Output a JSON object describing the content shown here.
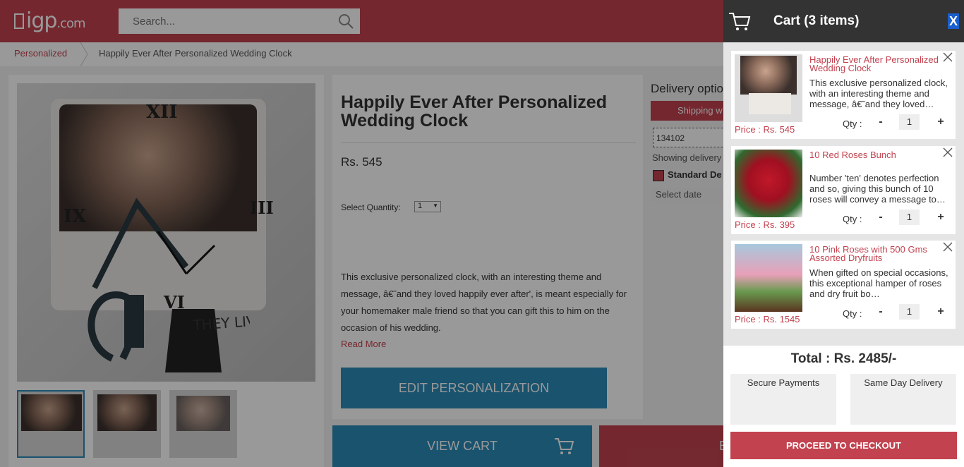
{
  "header": {
    "logo_text": "igp",
    "logo_suffix": ".com",
    "search_placeholder": "Search..."
  },
  "breadcrumb": {
    "parent": "Personalized",
    "current": "Happily Ever After Personalized Wedding Clock"
  },
  "product": {
    "title": "Happily Ever After Personalized Wedding Clock",
    "price": "Rs. 545",
    "quantity_label": "Select Quantity:",
    "quantity_value": "1",
    "description": "This exclusive personalized clock, with an interesting theme and message, â€˜and they loved happily ever after', is meant especially for your homemaker male friend so that you can gift this to him on the occasion of his wedding.",
    "read_more": "Read More",
    "edit_button": "EDIT PERSONALIZATION",
    "view_cart_button": "VIEW CART",
    "buy_button_partial": "B",
    "image_text": "THEY LIVED HAPPILY EVER...AFTER..."
  },
  "delivery": {
    "title": "Delivery optio",
    "shipping_tab": "Shipping w",
    "pincode": "134102",
    "showing_text": "Showing delivery",
    "standard_label": "Standard De",
    "select_date": "Select date"
  },
  "cart": {
    "title": "Cart (3 items)",
    "close_label": "X",
    "qty_label": "Qty :",
    "minus_label": "-",
    "plus_label": "+",
    "items": [
      {
        "name": "Happily Ever After Personalized Wedding Clock",
        "description": "This exclusive personalized clock, with an interesting theme and message, â€˜and they loved…",
        "price": "Price : Rs. 545",
        "qty": "1"
      },
      {
        "name": "10 Red Roses Bunch",
        "description": "Number 'ten' denotes perfection and so, giving this bunch of 10 roses will convey a message to…",
        "price": "Price : Rs. 395",
        "qty": "1"
      },
      {
        "name": "10 Pink Roses with 500 Gms Assorted Dryfruits",
        "description": "When gifted on special occasions, this exceptional hamper of roses and dry fruit bo…",
        "price": "Price : Rs. 1545",
        "qty": "1"
      }
    ],
    "total": "Total : Rs. 2485/-",
    "feature_1": "Secure Payments",
    "feature_2": "Same Day Delivery",
    "checkout_button": "PROCEED TO CHECKOUT"
  },
  "colors": {
    "brand_red": "#c2424f",
    "action_blue": "#2a8ab8",
    "cart_header": "#333333"
  }
}
